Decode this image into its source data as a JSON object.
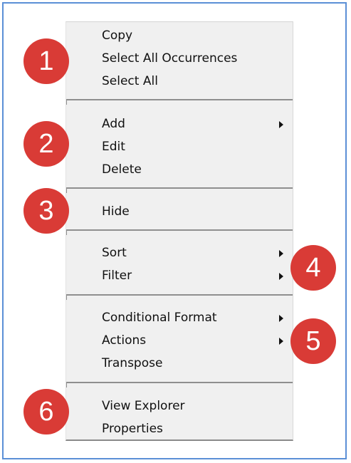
{
  "menu": {
    "copy": "Copy",
    "select_all_occurrences": "Select All Occurrences",
    "select_all": "Select All",
    "add": "Add",
    "edit": "Edit",
    "delete": "Delete",
    "hide": "Hide",
    "sort": "Sort",
    "filter": "Filter",
    "conditional_format": "Conditional Format",
    "actions": "Actions",
    "transpose": "Transpose",
    "view_explorer": "View Explorer",
    "properties": "Properties"
  },
  "callouts": [
    "1",
    "2",
    "3",
    "4",
    "5",
    "6"
  ],
  "colors": {
    "badge": "#d93b36",
    "frame": "#5b8fd6",
    "menu_bg": "#f0f0f0"
  }
}
